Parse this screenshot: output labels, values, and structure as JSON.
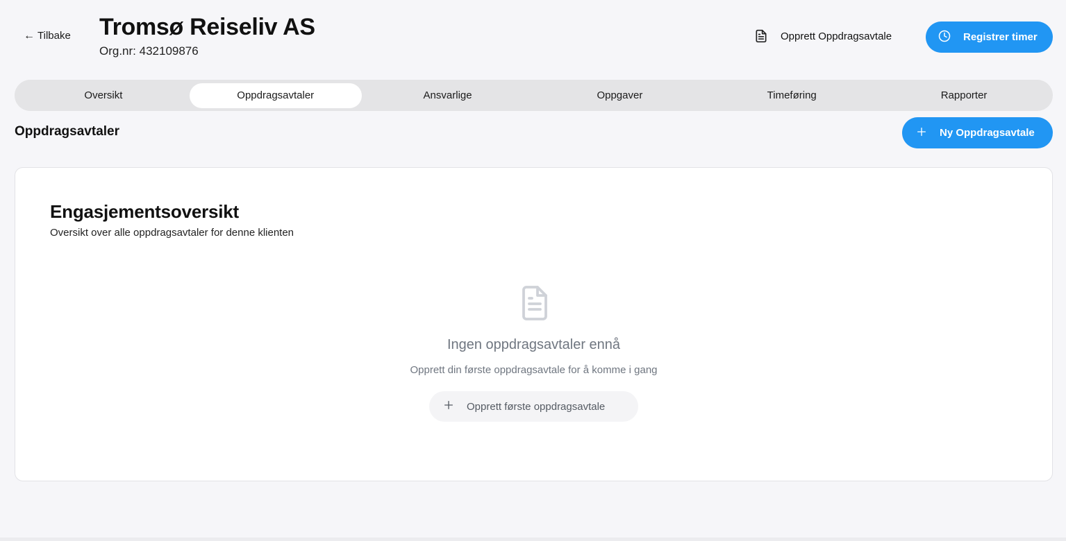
{
  "header": {
    "back_label": "Tilbake",
    "back_arrow": "←",
    "client_name": "Tromsø Reiseliv AS",
    "org_number": "Org.nr: 432109876",
    "create_agreement_label": "Opprett Oppdragsavtale",
    "register_hours_label": "Registrer timer"
  },
  "tabs": [
    {
      "label": "Oversikt",
      "active": false
    },
    {
      "label": "Oppdragsavtaler",
      "active": true
    },
    {
      "label": "Ansvarlige",
      "active": false
    },
    {
      "label": "Oppgaver",
      "active": false
    },
    {
      "label": "Timeføring",
      "active": false
    },
    {
      "label": "Rapporter",
      "active": false
    }
  ],
  "section": {
    "title": "Oppdragsavtaler",
    "new_button_label": "Ny Oppdragsavtale"
  },
  "card": {
    "title": "Engasjementsoversikt",
    "subtitle": "Oversikt over alle oppdragsavtaler for denne klienten",
    "empty_title": "Ingen oppdragsavtaler ennå",
    "empty_subtitle": "Opprett din første oppdragsavtale for å komme i gang",
    "first_button_label": "Opprett første oppdragsavtale"
  },
  "colors": {
    "accent": "#2196f3",
    "background": "#f6f6f9",
    "tab_bar": "#e4e4e6",
    "muted_text": "#6f7680"
  },
  "icons": {
    "back": "arrow-left-icon",
    "document": "document-icon",
    "clock": "clock-icon",
    "plus": "plus-icon",
    "empty": "document-icon"
  }
}
